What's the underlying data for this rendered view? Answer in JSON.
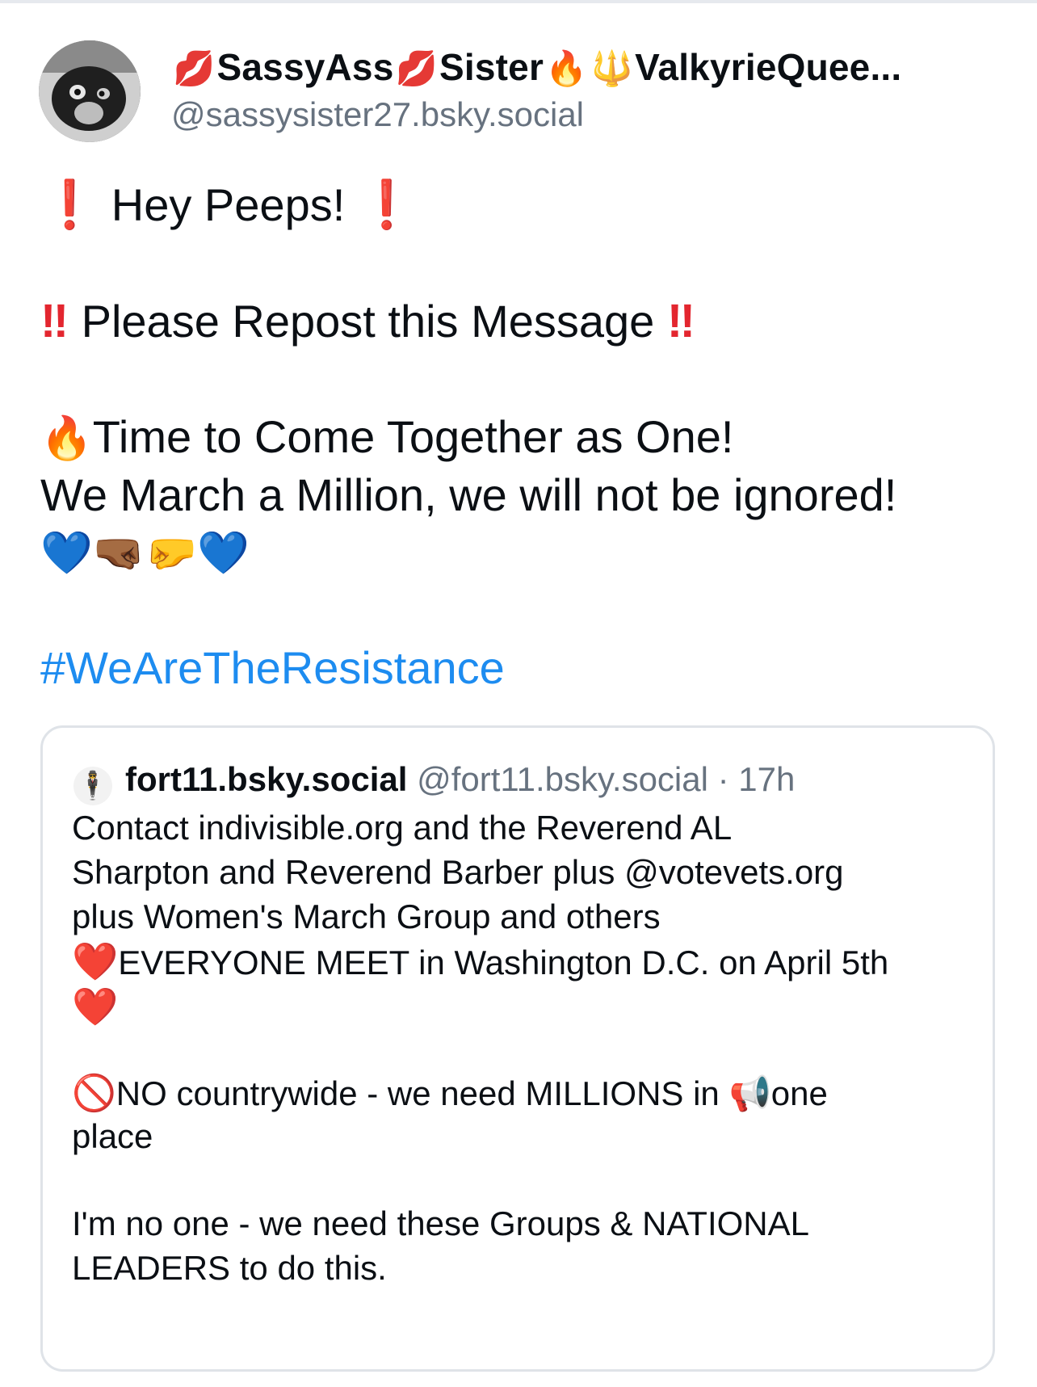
{
  "post": {
    "author": {
      "display_name_parts": [
        "💋",
        "SassyAss",
        "💋",
        "Sister",
        "🔥",
        "🔱",
        "ValkyrieQuee..."
      ],
      "handle": "@sassysister27.bsky.social"
    },
    "lines": {
      "l1_mark": "❗",
      "l1_text": " Hey Peeps! ",
      "l1_mark2": "❗",
      "l2_mark": "‼",
      "l2_text": " Please Repost this Message ",
      "l2_mark2": "‼",
      "l3_emoji": "🔥",
      "l3_text": "Time to Come Together as One!",
      "l4_text": "We March a Million, we will not be ignored!",
      "l5_emojis": "💙🤜🏾🤛💙"
    },
    "hashtag": "#WeAreTheResistance"
  },
  "quote": {
    "avatar_emoji": "🕴",
    "name": "fort11.bsky.social",
    "handle": "@fort11.bsky.social",
    "separator": " · ",
    "time": "17h",
    "lines": {
      "q1": "Contact indivisible.org and the Reverend AL",
      "q2": "Sharpton and Reverend Barber plus @votevets.org",
      "q3": "plus Women's March Group and others",
      "q4_heart": "❤️",
      "q4_text": "EVERYONE MEET in Washington D.C. on April 5th",
      "q5_heart": "❤️",
      "q6_icon": "🚫",
      "q6_text": "NO countrywide - we need MILLIONS in ",
      "q6_megaphone": "📢",
      "q6_tail": "one",
      "q7": "place",
      "q8": "I'm no one - we need these Groups & NATIONAL",
      "q9": "LEADERS to do this."
    }
  },
  "colors": {
    "hashtag": "#1d8cf0",
    "muted": "#67727f",
    "alert_red": "#e3262f",
    "card_border": "#dfe3e8"
  }
}
